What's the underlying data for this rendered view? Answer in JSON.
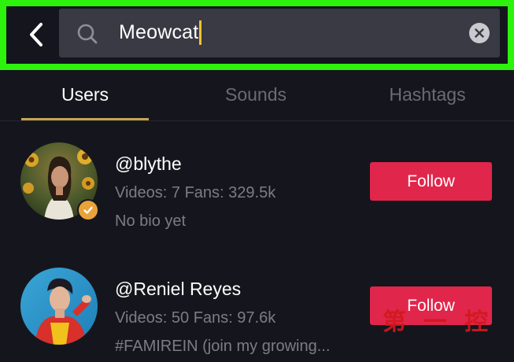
{
  "search": {
    "query": "Meowcat"
  },
  "tabs": [
    {
      "label": "Users",
      "active": true
    },
    {
      "label": "Sounds",
      "active": false
    },
    {
      "label": "Hashtags",
      "active": false
    }
  ],
  "users": [
    {
      "username": "@blythe",
      "stats": "Videos: 7 Fans: 329.5k",
      "bio": "No bio yet",
      "verified": true,
      "follow_label": "Follow"
    },
    {
      "username": "@Reniel Reyes",
      "stats": "Videos: 50 Fans: 97.6k",
      "bio": "#FAMIREIN (join my growing...",
      "verified": false,
      "follow_label": "Follow"
    }
  ],
  "colors": {
    "background": "#15161d",
    "highlight_border": "#2cf20d",
    "follow_button": "#e1264b",
    "tab_underline": "#c7a453",
    "caret": "#f2c230",
    "verified_badge": "#e9a33a"
  },
  "icons": [
    "back-arrow-icon",
    "search-icon",
    "clear-icon",
    "verified-icon"
  ],
  "watermark": "第一控"
}
